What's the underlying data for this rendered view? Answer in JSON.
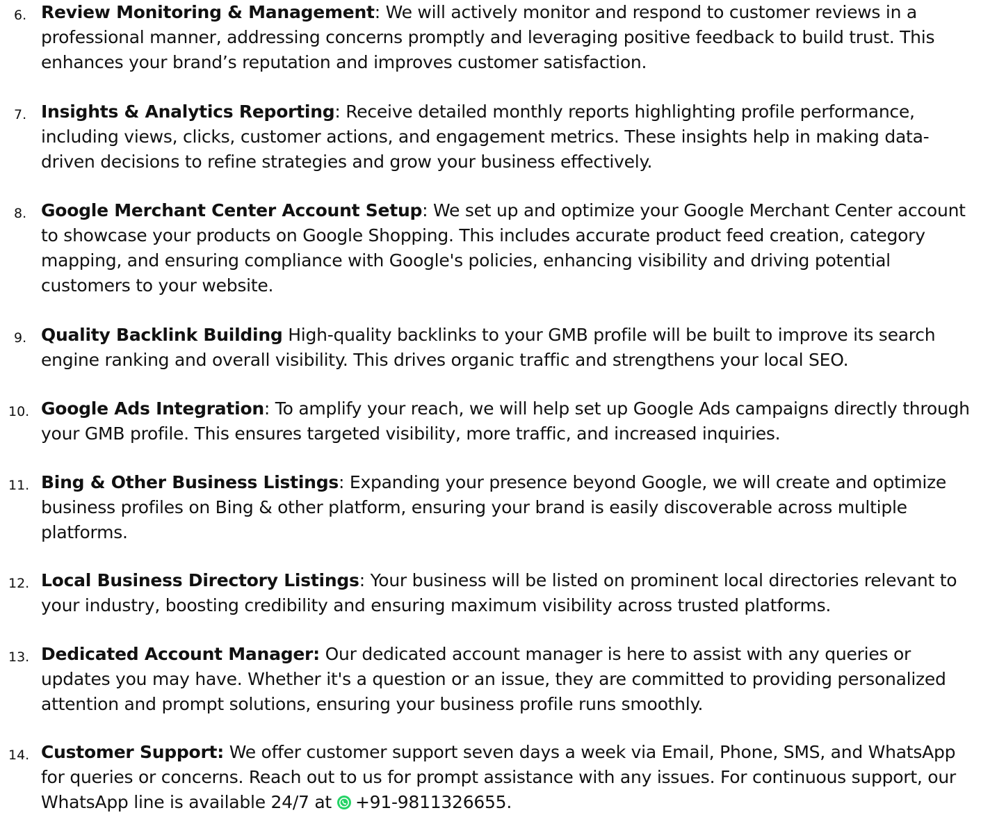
{
  "items": [
    {
      "number": "6.",
      "title": "Review Monitoring & Management",
      "sep": ":",
      "body": " We will actively monitor and respond to customer reviews in a professional manner, addressing concerns promptly and leveraging positive feedback to build trust. This enhances your brand’s reputation and improves customer satisfaction."
    },
    {
      "number": "7.",
      "title": "Insights & Analytics Reporting",
      "sep": ":",
      "body": " Receive detailed monthly reports highlighting profile performance, including views, clicks, customer actions, and engagement metrics. These insights help in making data-driven decisions to refine strategies and grow your business effectively."
    },
    {
      "number": "8.",
      "title": "Google Merchant Center Account Setup",
      "sep": ":",
      "body": " We set up and optimize your Google Merchant Center account to showcase your products on Google Shopping. This includes accurate product feed creation, category mapping, and ensuring compliance with Google's policies, enhancing visibility and driving potential customers to your website."
    },
    {
      "number": "9.",
      "title": "Quality Backlink Building",
      "sep": "",
      "body": " High-quality backlinks to your GMB profile will be built to improve its search engine ranking and overall visibility. This drives organic traffic and strengthens your local SEO."
    },
    {
      "number": "10.",
      "title": "Google Ads Integration",
      "sep": ":",
      "body": " To amplify your reach, we will help set up Google Ads campaigns directly through your GMB profile. This ensures targeted visibility, more traffic, and increased inquiries."
    },
    {
      "number": "11.",
      "title": "Bing & Other Business Listings",
      "sep": ":",
      "body": " Expanding your presence beyond Google, we will create and optimize business profiles on Bing & other platform, ensuring your brand is easily discoverable across multiple platforms."
    },
    {
      "number": "12.",
      "title": "Local Business Directory Listings",
      "sep": ":",
      "body": " Your business will be listed on prominent local directories relevant to your industry, boosting credibility and ensuring maximum visibility across trusted platforms."
    },
    {
      "number": "13.",
      "title": "Dedicated Account Manager:",
      "sep": "",
      "body": " Our dedicated account manager is here to assist with any queries or updates you may have. Whether it's a question or an issue, they are committed to providing personalized attention and prompt solutions, ensuring your business profile runs smoothly."
    },
    {
      "number": "14.",
      "title": "Customer Support:",
      "sep": "",
      "body": " We offer customer support seven days a week via Email, Phone, SMS, and WhatsApp for queries or concerns. Reach out to us for prompt assistance with any issues. For continuous support, our WhatsApp line is available 24/7 at",
      "phone": "+91-9811326655.",
      "icon": "whatsapp-icon",
      "icon_color": "#25d366"
    }
  ]
}
